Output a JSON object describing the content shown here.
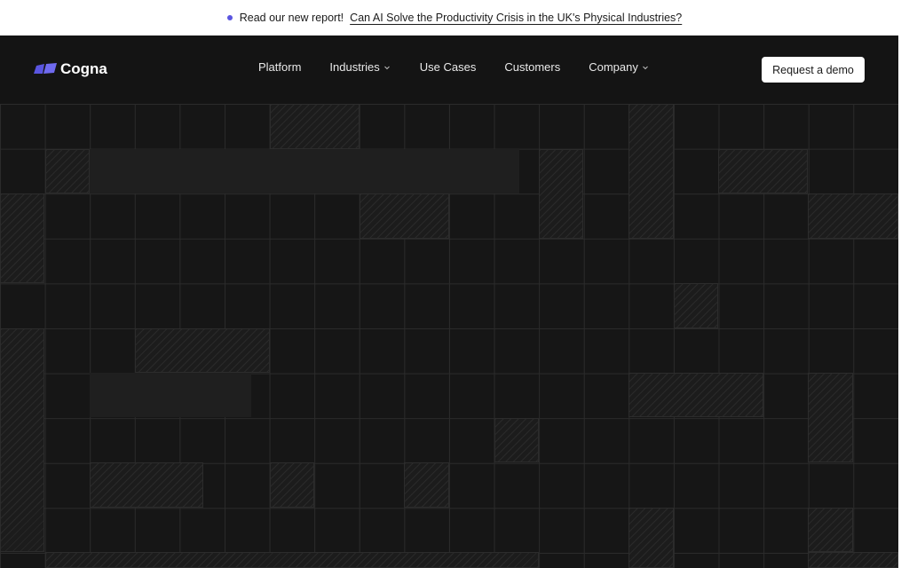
{
  "announcement": {
    "lead": "Read our new report!",
    "link": "Can AI Solve the Productivity Crisis in the UK's Physical Industries?",
    "dot_color": "#5a55e0"
  },
  "brand": {
    "name": "Cogna",
    "logo_color": "#5a55e0"
  },
  "nav": {
    "items": [
      {
        "label": "Platform",
        "has_dropdown": false
      },
      {
        "label": "Industries",
        "has_dropdown": true
      },
      {
        "label": "Use Cases",
        "has_dropdown": false
      },
      {
        "label": "Customers",
        "has_dropdown": false
      },
      {
        "label": "Company",
        "has_dropdown": true
      }
    ],
    "cta": "Request a demo"
  },
  "theme": {
    "background": "#141414",
    "grid_line": "#2b2b2b",
    "announcement_bg": "#ffffff",
    "cta_bg": "#ffffff"
  }
}
